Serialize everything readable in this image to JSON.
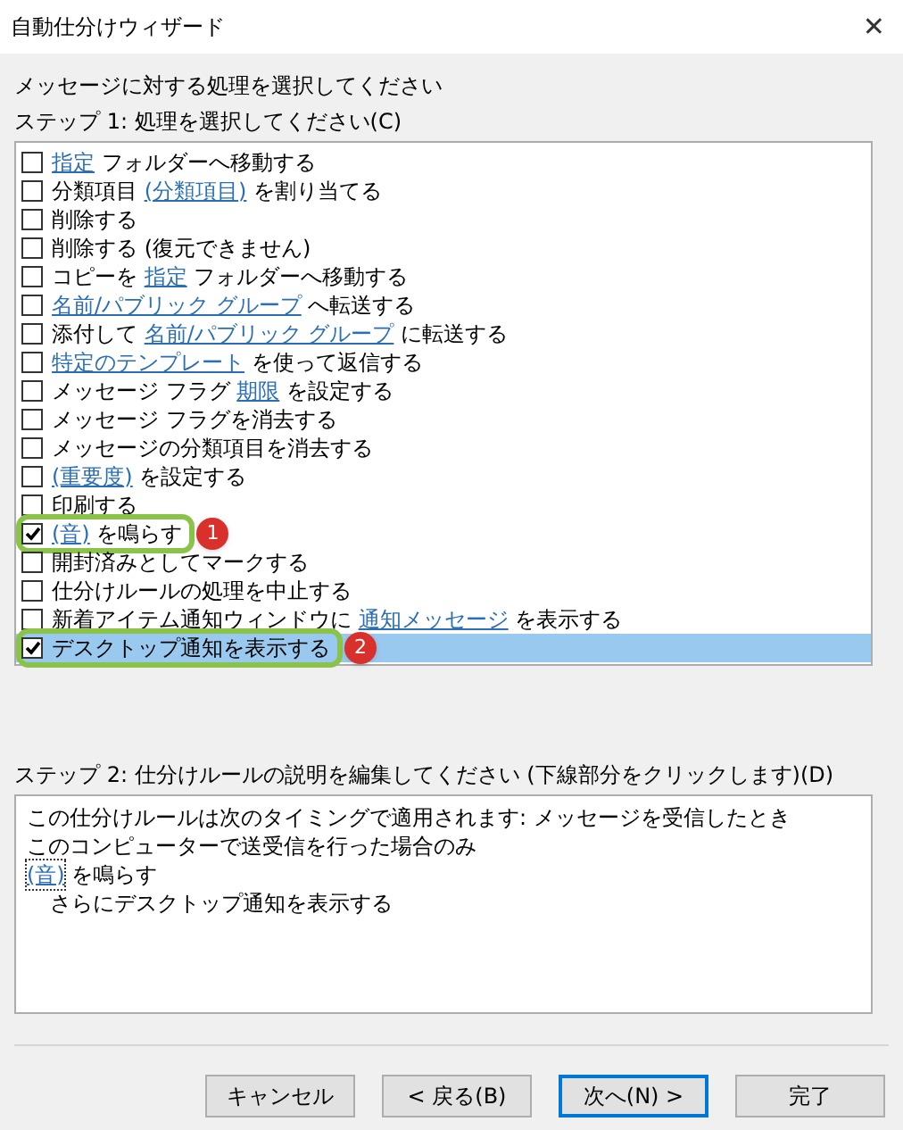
{
  "window": {
    "title": "自動仕分けウィザード",
    "close": "✕"
  },
  "prompt": "メッセージに対する処理を選択してください",
  "step1": {
    "label": "ステップ 1: 処理を選択してください(C)",
    "items": [
      {
        "checked": false,
        "selected": false,
        "parts": [
          {
            "kind": "link",
            "text": "指定"
          },
          {
            "kind": "text",
            "text": " フォルダーへ移動する"
          }
        ]
      },
      {
        "checked": false,
        "selected": false,
        "parts": [
          {
            "kind": "text",
            "text": "分類項目 "
          },
          {
            "kind": "link",
            "text": "(分類項目)"
          },
          {
            "kind": "text",
            "text": " を割り当てる"
          }
        ]
      },
      {
        "checked": false,
        "selected": false,
        "parts": [
          {
            "kind": "text",
            "text": "削除する"
          }
        ]
      },
      {
        "checked": false,
        "selected": false,
        "parts": [
          {
            "kind": "text",
            "text": "削除する (復元できません)"
          }
        ]
      },
      {
        "checked": false,
        "selected": false,
        "parts": [
          {
            "kind": "text",
            "text": "コピーを "
          },
          {
            "kind": "link",
            "text": "指定"
          },
          {
            "kind": "text",
            "text": " フォルダーへ移動する"
          }
        ]
      },
      {
        "checked": false,
        "selected": false,
        "parts": [
          {
            "kind": "link",
            "text": "名前/パブリック グループ"
          },
          {
            "kind": "text",
            "text": " へ転送する"
          }
        ]
      },
      {
        "checked": false,
        "selected": false,
        "parts": [
          {
            "kind": "text",
            "text": "添付して "
          },
          {
            "kind": "link",
            "text": "名前/パブリック グループ"
          },
          {
            "kind": "text",
            "text": " に転送する"
          }
        ]
      },
      {
        "checked": false,
        "selected": false,
        "parts": [
          {
            "kind": "link",
            "text": "特定のテンプレート"
          },
          {
            "kind": "text",
            "text": " を使って返信する"
          }
        ]
      },
      {
        "checked": false,
        "selected": false,
        "parts": [
          {
            "kind": "text",
            "text": "メッセージ フラグ "
          },
          {
            "kind": "link",
            "text": "期限"
          },
          {
            "kind": "text",
            "text": " を設定する"
          }
        ]
      },
      {
        "checked": false,
        "selected": false,
        "parts": [
          {
            "kind": "text",
            "text": "メッセージ フラグを消去する"
          }
        ]
      },
      {
        "checked": false,
        "selected": false,
        "parts": [
          {
            "kind": "text",
            "text": "メッセージの分類項目を消去する"
          }
        ]
      },
      {
        "checked": false,
        "selected": false,
        "parts": [
          {
            "kind": "link",
            "text": "(重要度)"
          },
          {
            "kind": "text",
            "text": " を設定する"
          }
        ]
      },
      {
        "checked": false,
        "selected": false,
        "parts": [
          {
            "kind": "text",
            "text": "印刷する"
          }
        ]
      },
      {
        "checked": true,
        "selected": false,
        "callout": "1",
        "parts": [
          {
            "kind": "link",
            "text": "(音)"
          },
          {
            "kind": "text",
            "text": " を鳴らす"
          }
        ]
      },
      {
        "checked": false,
        "selected": false,
        "parts": [
          {
            "kind": "text",
            "text": "開封済みとしてマークする"
          }
        ]
      },
      {
        "checked": false,
        "selected": false,
        "parts": [
          {
            "kind": "text",
            "text": "仕分けルールの処理を中止する"
          }
        ]
      },
      {
        "checked": false,
        "selected": false,
        "parts": [
          {
            "kind": "text",
            "text": "新着アイテム通知ウィンドウに "
          },
          {
            "kind": "link",
            "text": "通知メッセージ"
          },
          {
            "kind": "text",
            "text": " を表示する"
          }
        ]
      },
      {
        "checked": true,
        "selected": true,
        "callout": "2",
        "parts": [
          {
            "kind": "text",
            "text": "デスクトップ通知を表示する"
          }
        ]
      }
    ]
  },
  "step2": {
    "label": "ステップ 2: 仕分けルールの説明を編集してください (下線部分をクリックします)(D)",
    "lines": [
      {
        "indent": false,
        "parts": [
          {
            "kind": "text",
            "text": "この仕分けルールは次のタイミングで適用されます: メッセージを受信したとき"
          }
        ]
      },
      {
        "indent": false,
        "parts": [
          {
            "kind": "text",
            "text": "このコンピューターで送受信を行った場合のみ"
          }
        ]
      },
      {
        "indent": false,
        "parts": [
          {
            "kind": "focused-link",
            "text": "(音)"
          },
          {
            "kind": "text",
            "text": " を鳴らす"
          }
        ]
      },
      {
        "indent": true,
        "parts": [
          {
            "kind": "text",
            "text": "さらにデスクトップ通知を表示する"
          }
        ]
      }
    ]
  },
  "buttons": [
    {
      "label": "キャンセル",
      "default": false
    },
    {
      "label": "< 戻る(B)",
      "default": false
    },
    {
      "label": "次へ(N) >",
      "default": true
    },
    {
      "label": "完了",
      "default": false
    }
  ]
}
